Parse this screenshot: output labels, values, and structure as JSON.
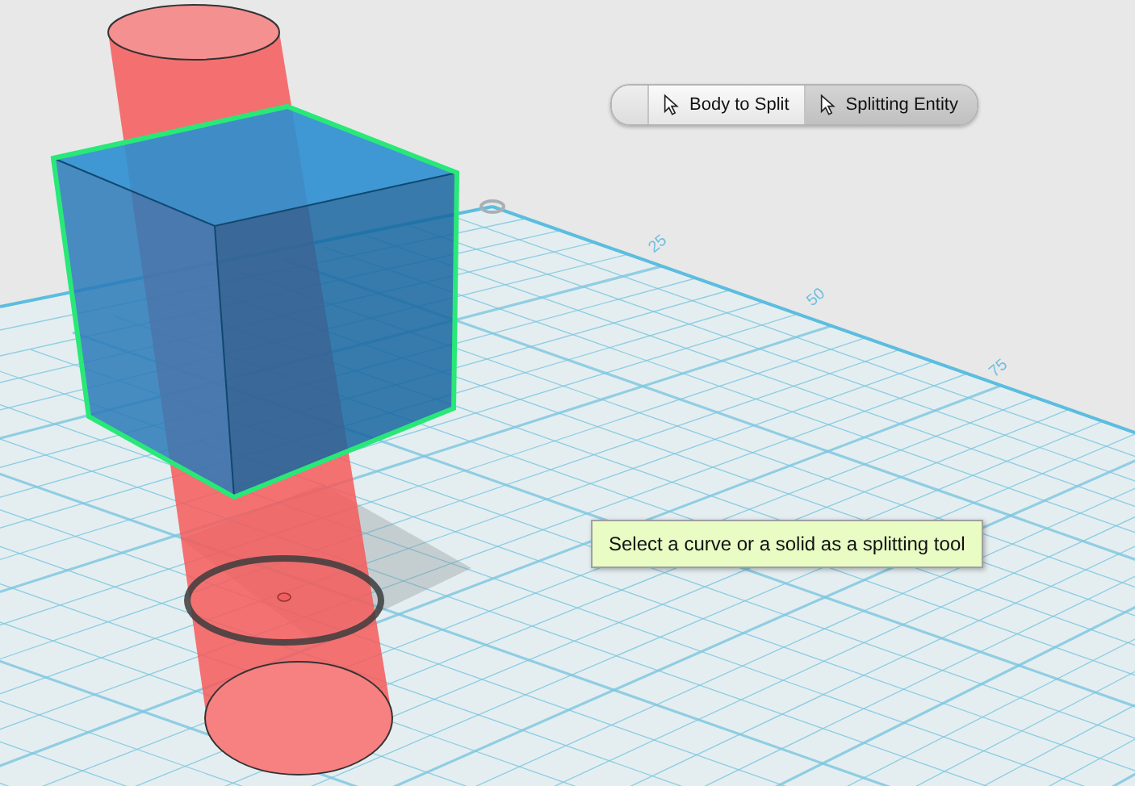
{
  "toolbar": {
    "buttons": [
      {
        "label": "Body to Split",
        "selected": false
      },
      {
        "label": "Splitting Entity",
        "selected": true
      }
    ]
  },
  "grid": {
    "axis_labels": [
      "25",
      "50",
      "75"
    ]
  },
  "tooltip": {
    "text": "Select a curve or a solid as a splitting tool"
  }
}
